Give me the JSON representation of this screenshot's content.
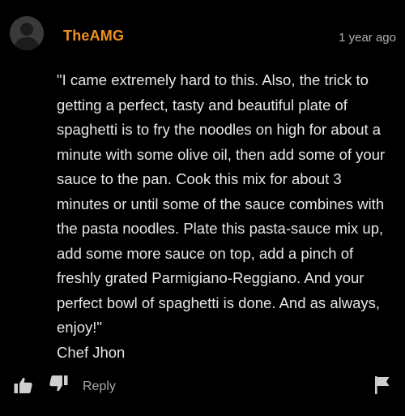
{
  "comment": {
    "username": "TheAMG",
    "timestamp": "1 year ago",
    "text": "\"I came extremely hard to this. Also, the trick to getting a perfect, tasty and beautiful plate of spaghetti is to fry the noodles on high for about a minute with some olive oil, then add some of your sauce to the pan. Cook this mix for about 3 minutes or until some of the sauce combines with the pasta noodles. Plate this pasta-sauce mix up, add some more sauce on top, add a pinch of freshly grated Parmigiano-Reggiano. And your perfect bowl of spaghetti is done. And as always, enjoy!\"\nChef Jhon",
    "avatar_icon": "default-user-icon"
  },
  "actions": {
    "like_icon": "thumbs-up-icon",
    "dislike_icon": "thumbs-down-icon",
    "reply_label": "Reply",
    "flag_icon": "flag-icon"
  },
  "colors": {
    "background": "#000000",
    "username": "#f0901e",
    "text": "#e6e6e6",
    "muted": "#b0b0b0"
  }
}
